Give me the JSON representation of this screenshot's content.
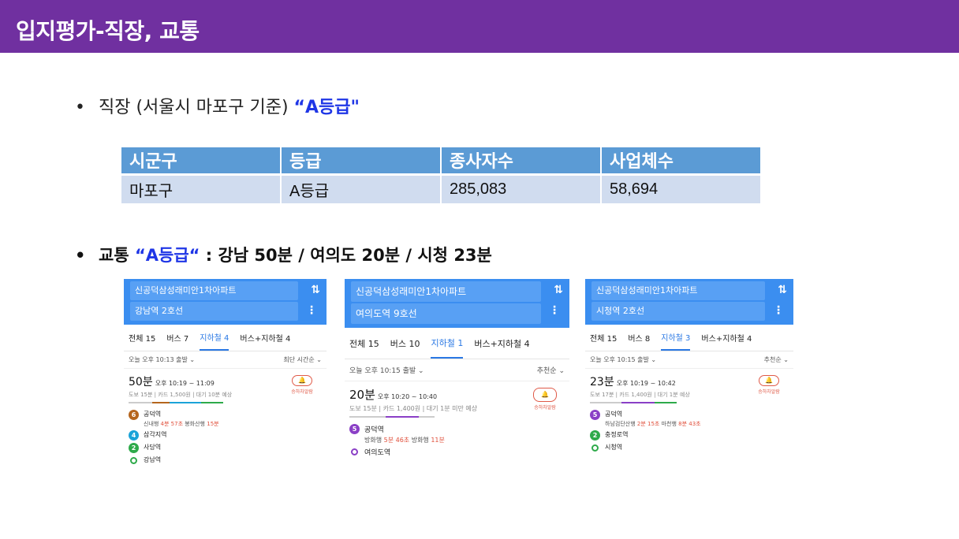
{
  "slide": {
    "title": "입지평가-직장, 교통",
    "bullet1": {
      "dot": "•",
      "text": "직장 (서울시 마포구 기준) ",
      "grade": "“A등급\""
    },
    "bullet2": {
      "dot": "•",
      "prefix": "교통 ",
      "grade": "“A등급“",
      "suffix": " : 강남 50분 / 여의도 20분 / 시청 23분"
    }
  },
  "table": {
    "headers": [
      "시군구",
      "등급",
      "종사자수",
      "사업체수"
    ],
    "row": [
      "마포구",
      "A등급",
      "285,083",
      "58,694"
    ]
  },
  "colors": {
    "title_bg": "#7030a0",
    "table_header": "#5b9bd5",
    "table_row": "#d0dcef",
    "accent_blue": "#1f36e6",
    "app_blue": "#3b8ef0"
  },
  "shots": [
    {
      "origin": "신공덕삼성래미안1차아파트",
      "dest": "강남역 2호선",
      "swap_icon": "⇅",
      "more_icon": "⋮",
      "tabs": [
        "전체 15",
        "버스 7",
        "지하철 4",
        "버스+지하철 4"
      ],
      "sort_left": "오늘 오후 10:13 출발 ⌄",
      "sort_right": "최단 시간순 ⌄",
      "duration": "50분",
      "time_range": "오후 10:19 ~ 11:09",
      "meta": "도보 15분 | 카드 1,500원 | 대기 10분 예상",
      "alarm": "승하차알람",
      "stops": [
        {
          "line": "6",
          "color": "#b5651d",
          "name": "공덕역",
          "sub_a": "신내행 ",
          "sub_a_time": "4분 57초",
          "sub_b": "  봉화산행 ",
          "sub_b_time": "15분"
        },
        {
          "line": "4",
          "color": "#1ba3d8",
          "name": "삼각지역"
        },
        {
          "line": "2",
          "color": "#2eaa4a",
          "name": "사당역"
        },
        {
          "line": "",
          "color": "#2eaa4a",
          "name": "강남역"
        }
      ]
    },
    {
      "origin": "신공덕삼성래미안1차아파트",
      "dest": "여의도역 9호선",
      "swap_icon": "⇅",
      "more_icon": "⋮",
      "tabs": [
        "전체 15",
        "버스 10",
        "지하철 1",
        "버스+지하철 4"
      ],
      "sort_left": "오늘 오후 10:15 출발 ⌄",
      "sort_right": "추천순 ⌄",
      "duration": "20분",
      "time_range": "오후 10:20 ~ 10:40",
      "meta": "도보 15분 | 카드 1,400원 | 대기 1분 미만 예상",
      "alarm": "승하차알람",
      "stops": [
        {
          "line": "5",
          "color": "#8a3fc6",
          "name": "공덕역",
          "sub_a": "방화행 ",
          "sub_a_time": "5분 46초",
          "sub_b": "  방화행 ",
          "sub_b_time": "11분"
        },
        {
          "line": "",
          "color": "#8a3fc6",
          "name": "여의도역"
        }
      ]
    },
    {
      "origin": "신공덕삼성래미안1차아파트",
      "dest": "시청역 2호선",
      "swap_icon": "⇅",
      "more_icon": "⋮",
      "tabs": [
        "전체 15",
        "버스 8",
        "지하철 3",
        "버스+지하철 4"
      ],
      "sort_left": "오늘 오후 10:15 출발 ⌄",
      "sort_right": "추천순 ⌄",
      "duration": "23분",
      "time_range": "오후 10:19 ~ 10:42",
      "meta": "도보 17분 | 카드 1,400원 | 대기 1분 예상",
      "alarm": "승하차알람",
      "stops": [
        {
          "line": "5",
          "color": "#8a3fc6",
          "name": "공덕역",
          "sub_a": "하남검단산행 ",
          "sub_a_time": "2분 15초",
          "sub_b": "  마천행 ",
          "sub_b_time": "8분 43초"
        },
        {
          "line": "2",
          "color": "#2eaa4a",
          "name": "충정로역"
        },
        {
          "line": "",
          "color": "#2eaa4a",
          "name": "시청역"
        }
      ]
    }
  ]
}
